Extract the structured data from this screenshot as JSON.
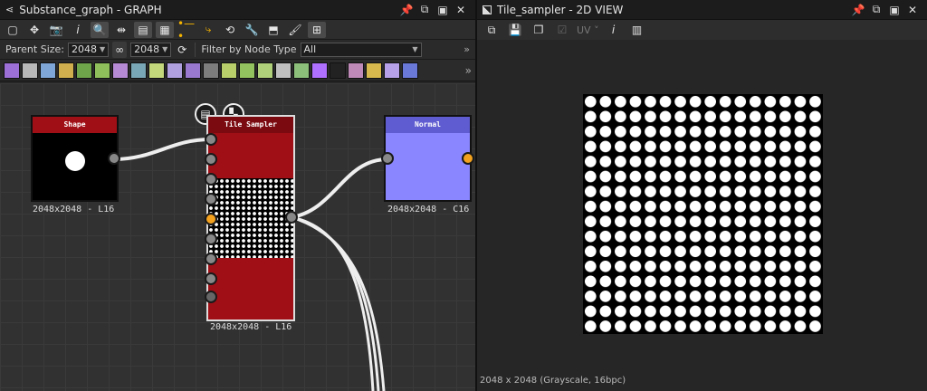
{
  "graph_panel": {
    "title": "Substance_graph - GRAPH",
    "parent_size_label": "Parent Size:",
    "parent_size_value": "2048",
    "parent_size_value2": "2048",
    "filter_label": "Filter by Node Type",
    "filter_value": "All"
  },
  "nodes": {
    "shape": {
      "title": "Shape",
      "label": "2048x2048 - L16"
    },
    "tile_sampler": {
      "title": "Tile Sampler",
      "label": "2048x2048 - L16"
    },
    "normal": {
      "title": "Normal",
      "label": "2048x2048 - C16"
    }
  },
  "view_panel": {
    "title": "Tile_sampler - 2D VIEW",
    "uv_label": "UV",
    "status": "2048 x 2048 (Grayscale, 16bpc)"
  },
  "palette_colors": [
    "#9b6fd6",
    "#b8b8b8",
    "#7fa8d8",
    "#d0b04e",
    "#6ea44a",
    "#8fbf5a",
    "#b68ad4",
    "#7aa7b5",
    "#c3d77b",
    "#b0a0e0",
    "#9a7ad0",
    "#7d7d7d",
    "#b9d06a",
    "#93c35f",
    "#b1d07a",
    "#c0c0c0",
    "#8cbf7a",
    "#b070ff",
    "#222222",
    "#c08ab8",
    "#d7b94d",
    "#b7a2ea",
    "#6a78d8"
  ],
  "colors": {
    "node_red": "#a10f16",
    "node_normal": "#8a86ff",
    "port_orange": "#f3a21f"
  }
}
